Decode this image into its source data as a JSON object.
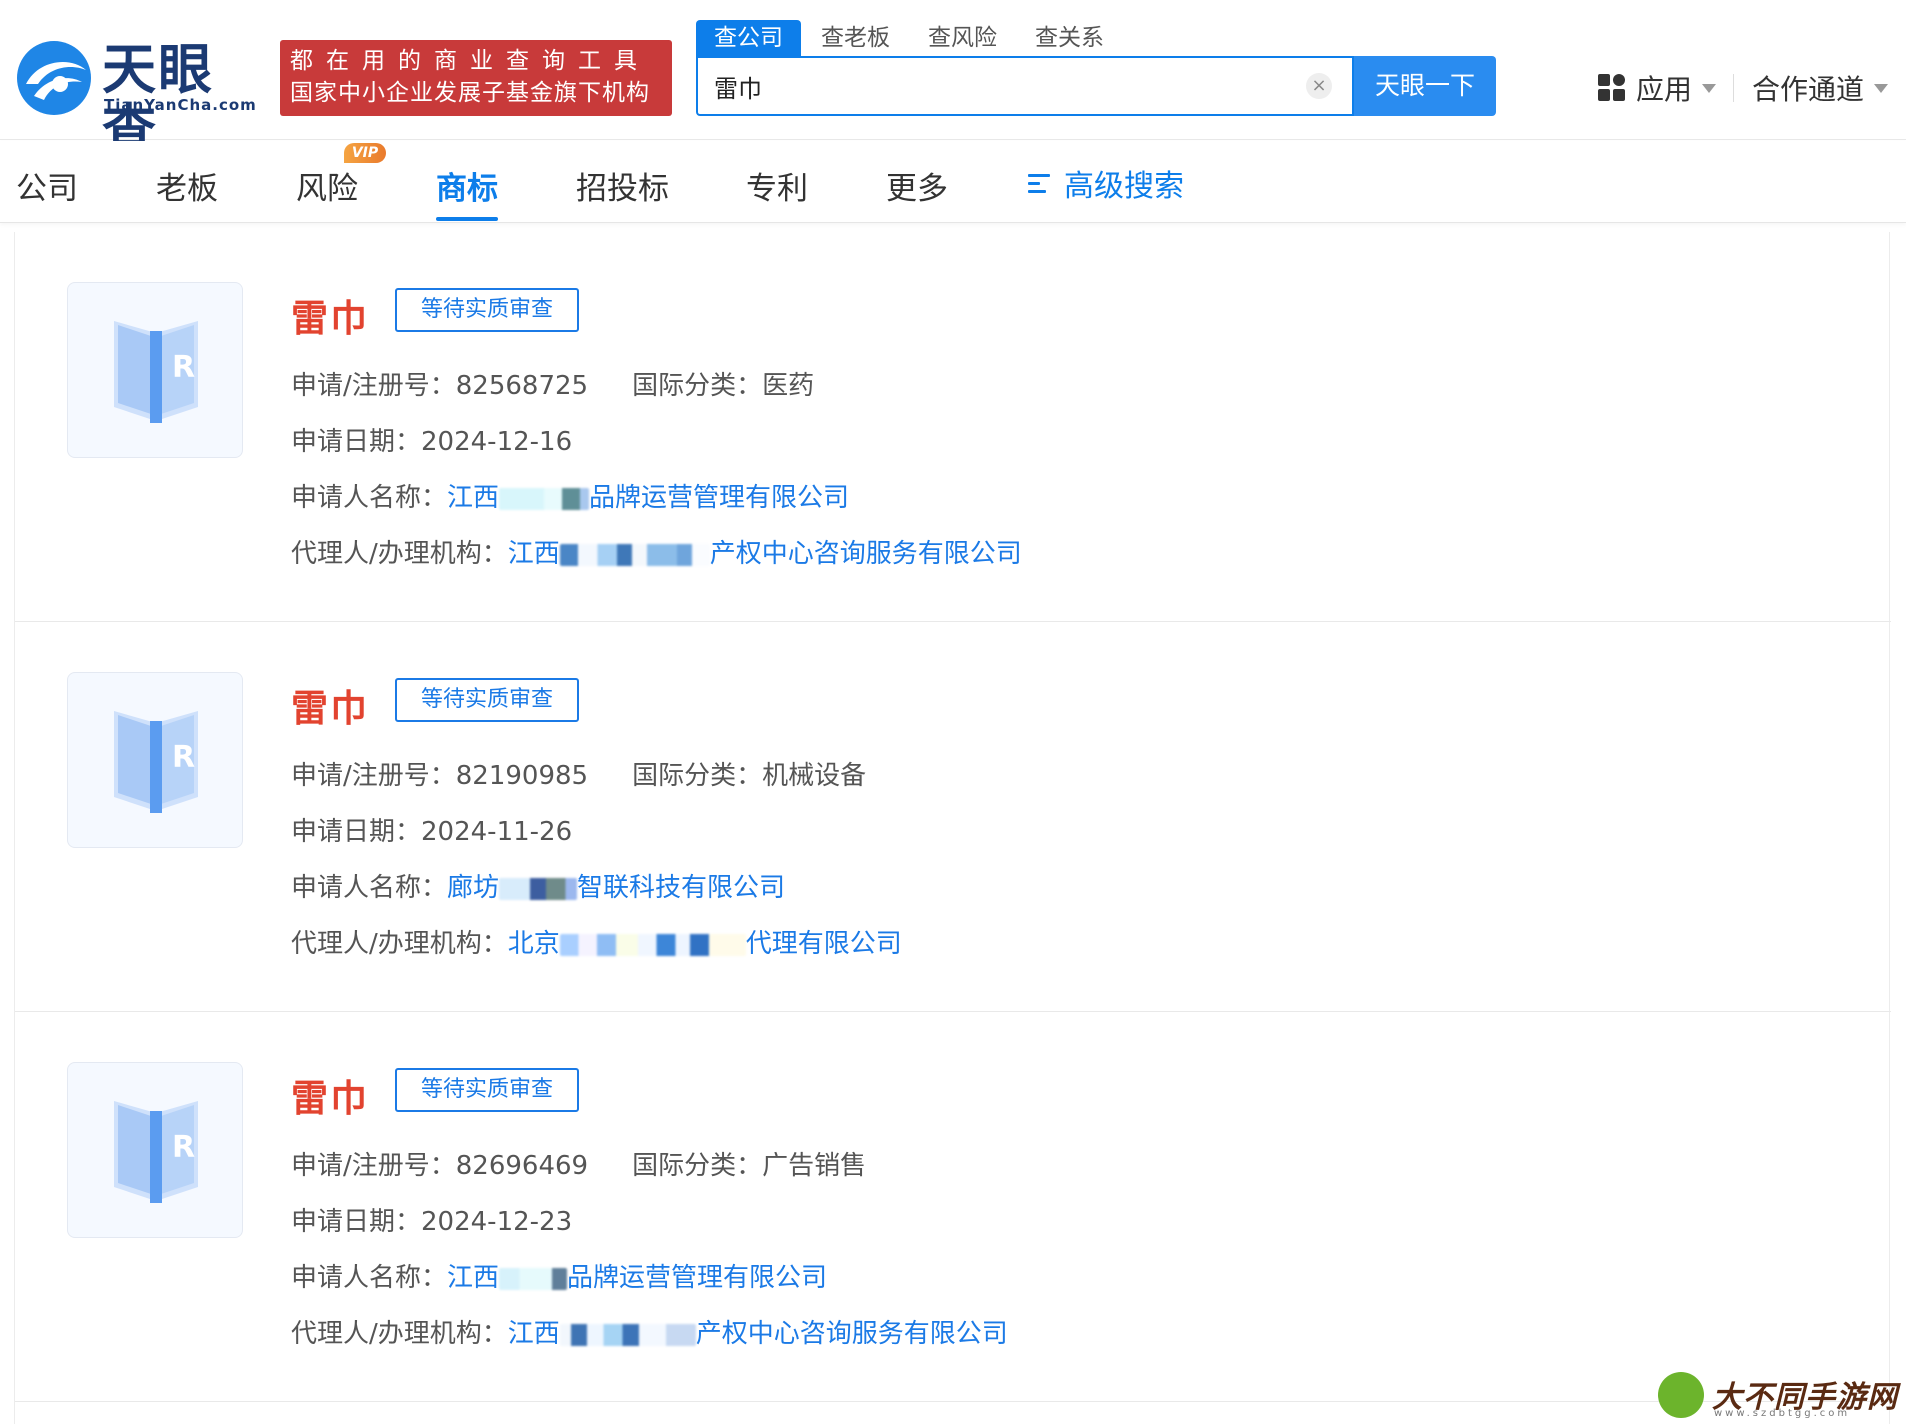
{
  "header": {
    "logo": {
      "name": "天眼查",
      "domain": "TianYanCha.com"
    },
    "slogan": {
      "line1": "都在用的商业查询工具",
      "line2": "国家中小企业发展子基金旗下机构"
    },
    "search_tabs": [
      "查公司",
      "查老板",
      "查风险",
      "查关系"
    ],
    "search": {
      "value": "雷巾",
      "button": "天眼一下",
      "clear": "×"
    },
    "apps": "应用",
    "cooperation": "合作通道"
  },
  "nav": {
    "items": [
      "公司",
      "老板",
      "风险",
      "商标",
      "招投标",
      "专利",
      "更多"
    ],
    "active": "商标",
    "vip_badge": "VIP",
    "advanced_search": "高级搜索"
  },
  "labels": {
    "reg_no": "申请/注册号：",
    "intl_class": "国际分类：",
    "apply_date": "申请日期：",
    "applicant": "申请人名称：",
    "agent": "代理人/办理机构："
  },
  "results": [
    {
      "name": "雷巾",
      "status": "等待实质审查",
      "reg_no": "82568725",
      "intl_class": "医药",
      "apply_date": "2024-12-16",
      "applicant_prefix": "江西",
      "applicant_suffix": "品牌运营管理有限公司",
      "agent_prefix": "江西",
      "agent_suffix": "产权中心咨询服务有限公司"
    },
    {
      "name": "雷巾",
      "status": "等待实质审查",
      "reg_no": "82190985",
      "intl_class": "机械设备",
      "apply_date": "2024-11-26",
      "applicant_prefix": "廊坊",
      "applicant_suffix": "智联科技有限公司",
      "agent_prefix": "北京",
      "agent_suffix": "代理有限公司"
    },
    {
      "name": "雷巾",
      "status": "等待实质审查",
      "reg_no": "82696469",
      "intl_class": "广告销售",
      "apply_date": "2024-12-23",
      "applicant_prefix": "江西",
      "applicant_suffix": "品牌运营管理有限公司",
      "agent_prefix": "江西",
      "agent_suffix": "产权中心咨询服务有限公司"
    }
  ],
  "watermark": {
    "text": "大不同手游网",
    "url": "www.szdbtgg.com"
  },
  "colors": {
    "accent": "#0d7eea",
    "trademark_name": "#e2432f",
    "slogan_bg": "#c83a3a",
    "link": "#1b7ae6"
  }
}
